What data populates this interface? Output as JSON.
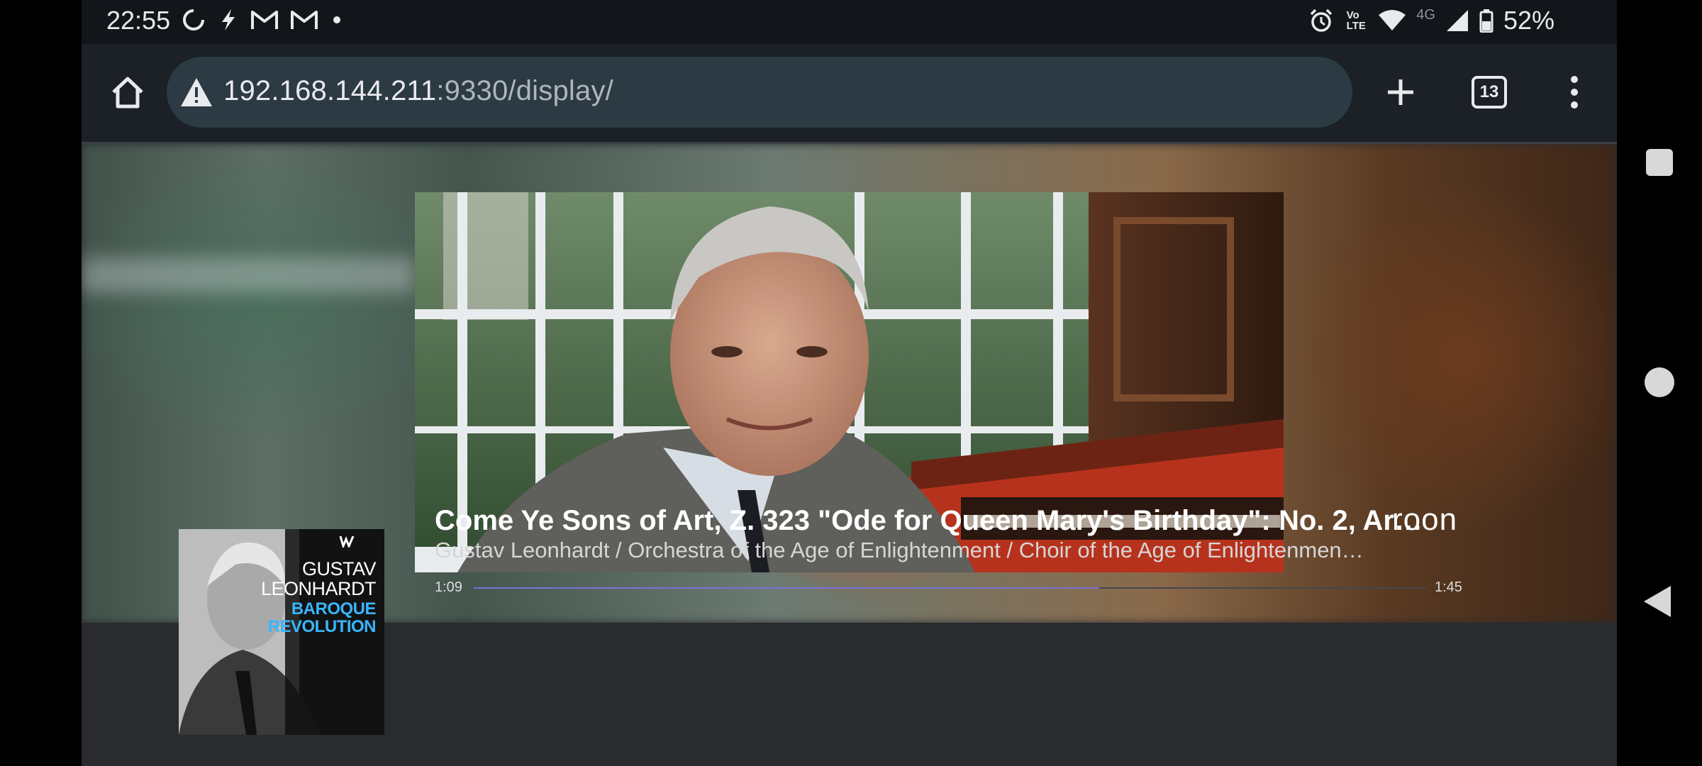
{
  "status_bar": {
    "time": "22:55",
    "battery": "52%",
    "network": "4G",
    "volte": "Vo\nLTE",
    "left_icons": [
      "sync-icon",
      "bolt-icon",
      "gmail-icon",
      "gmail-icon",
      "dot-icon"
    ],
    "right_icons": [
      "alarm-icon",
      "volte-icon",
      "wifi-icon",
      "signal-icon",
      "battery-icon"
    ]
  },
  "browser": {
    "url_host": "192.168.144.211",
    "url_rest": ":9330/display/",
    "tab_count": "13"
  },
  "now_playing": {
    "track_title": "Come Ye Sons of Art, Z. 323 \"Ode for Queen Mary's Birthday\": No. 2, Ar…",
    "artists": "Gustav Leonhardt / Orchestra of the Age of Enlightenment / Choir of the Age of Enlightenmen…",
    "elapsed": "1:09",
    "duration": "1:45",
    "progress_fraction": 0.657,
    "logo": "roon",
    "accent_color": "#7c71d6"
  },
  "album": {
    "artist_line1": "GUSTAV",
    "artist_line2": "LEONHARDT",
    "title_line1": "BAROQUE",
    "title_line2": "REVOLUTION",
    "title_color": "#38b6ff"
  }
}
